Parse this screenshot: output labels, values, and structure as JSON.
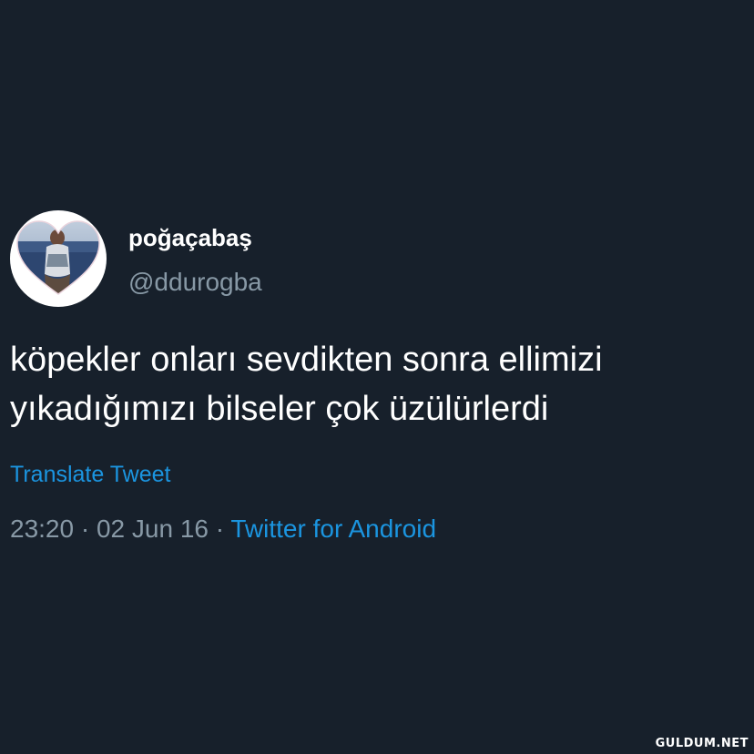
{
  "tweet": {
    "display_name": "poğaçabaş",
    "handle": "@ddurogba",
    "text_lines": [
      "köpekler onları sevdikten sonra ellimizi",
      "yıkadığımızı bilseler çok üzülürlerdi"
    ],
    "translate_label": "Translate Tweet",
    "time": "23:20",
    "separator": " · ",
    "date": "02 Jun 16",
    "source": "Twitter for Android"
  },
  "watermark": "GULDUM.NET",
  "colors": {
    "background": "#17202b",
    "text": "#ffffff",
    "secondary": "#8899a6",
    "link": "#1b95e0"
  }
}
